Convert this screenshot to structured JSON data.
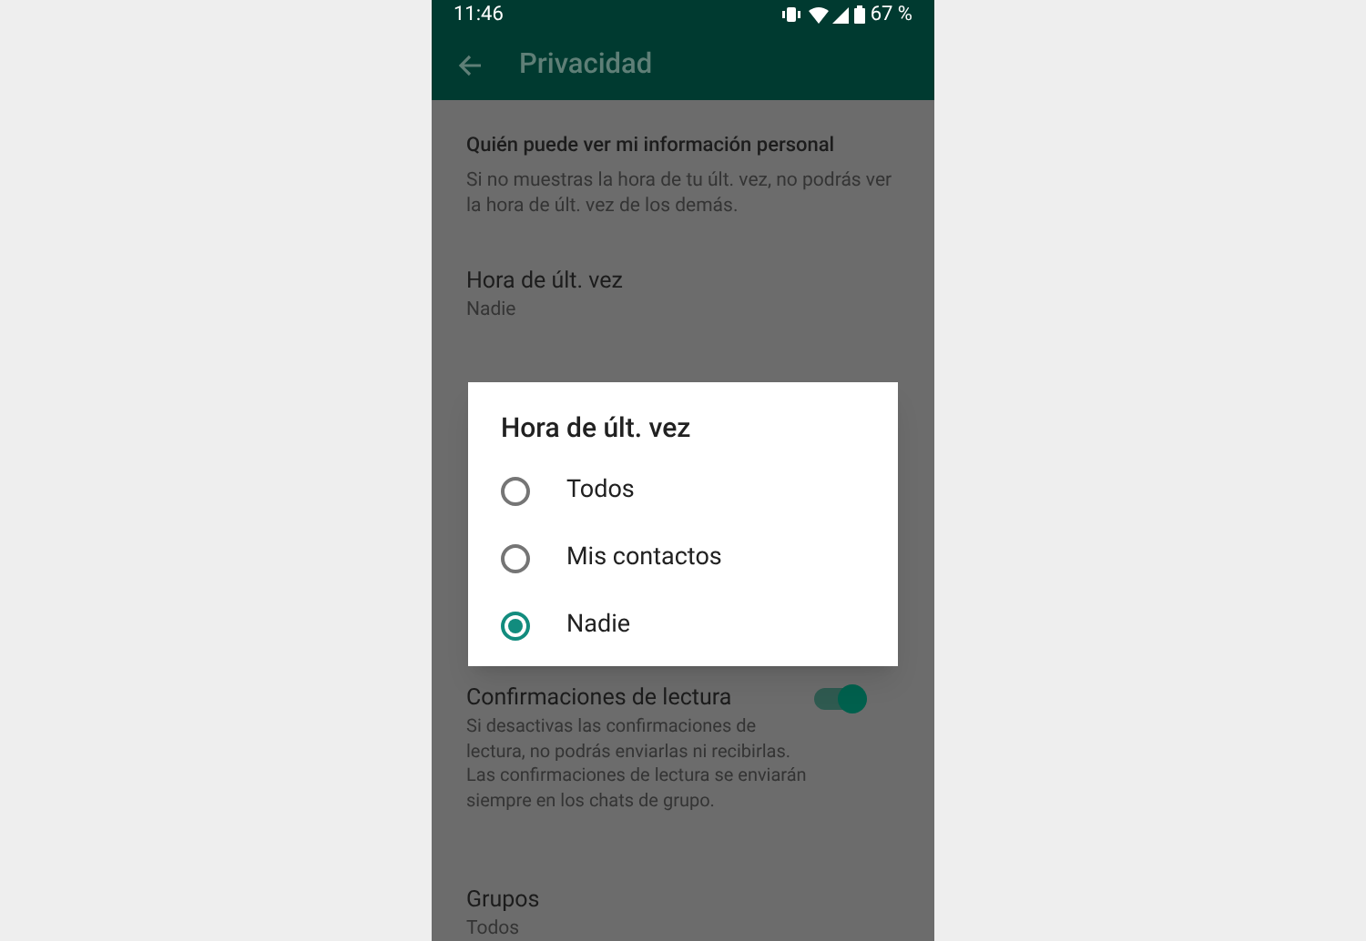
{
  "status_bar": {
    "time": "11:46",
    "battery": "67 %"
  },
  "toolbar": {
    "title": "Privacidad"
  },
  "section": {
    "heading": "Quién puede ver mi información personal",
    "description": "Si no muestras la hora de tu últ. vez, no podrás ver la hora de últ. vez de los demás."
  },
  "settings": [
    {
      "kind": "choice",
      "title": "Hora de últ. vez",
      "value": "Nadie"
    },
    {
      "kind": "toggle",
      "title": "Confirmaciones de lectura",
      "description": "Si desactivas las confirmaciones de lectura, no podrás enviarlas ni recibirlas. Las confirmaciones de lectura se enviarán siempre en los chats de grupo.",
      "on": true
    },
    {
      "kind": "choice",
      "title": "Grupos",
      "value": "Todos"
    }
  ],
  "dialog": {
    "title": "Hora de últ. vez",
    "options": [
      {
        "label": "Todos",
        "selected": false
      },
      {
        "label": "Mis contactos",
        "selected": false
      },
      {
        "label": "Nadie",
        "selected": true
      }
    ]
  }
}
